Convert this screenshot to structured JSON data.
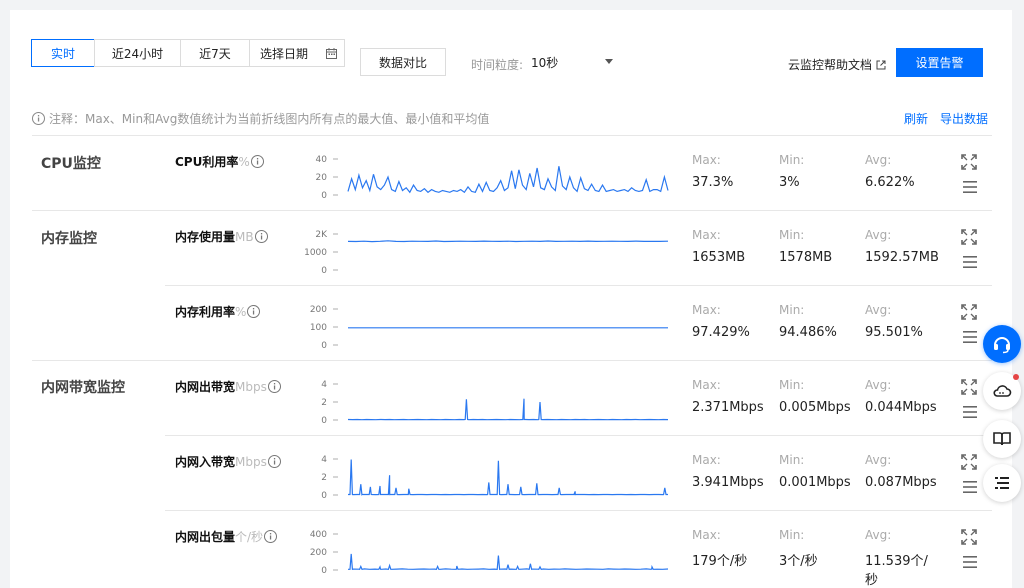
{
  "toolbar": {
    "tabs": [
      {
        "label": "实时",
        "active": true
      },
      {
        "label": "近24小时",
        "active": false
      },
      {
        "label": "近7天",
        "active": false
      }
    ],
    "date_picker_label": "选择日期",
    "compare_label": "数据对比",
    "granularity_label": "时间粒度:",
    "granularity_value": "10秒",
    "doc_link": "云监控帮助文档",
    "alarm_button": "设置告警"
  },
  "note": "注释：Max、Min和Avg数值统计为当前折线图内所有点的最大值、最小值和平均值",
  "actions": {
    "refresh": "刷新",
    "export": "导出数据"
  },
  "stat_labels": {
    "max": "Max:",
    "min": "Min:",
    "avg": "Avg:"
  },
  "groups": [
    {
      "label": "CPU监控"
    },
    {
      "label": "内存监控"
    },
    {
      "label": "内网带宽监控"
    }
  ],
  "metrics": [
    {
      "name": "CPU利用率",
      "unit": "%",
      "y_ticks": [
        "40",
        "20",
        "0"
      ],
      "ylim": [
        0,
        40
      ],
      "series": [
        4,
        18,
        6,
        22,
        8,
        16,
        5,
        23,
        9,
        6,
        11,
        20,
        6,
        4,
        15,
        5,
        8,
        3,
        11,
        5,
        4,
        7,
        3,
        6,
        4,
        3,
        5,
        4,
        3,
        5,
        4,
        6,
        3,
        9,
        4,
        3,
        12,
        4,
        14,
        5,
        4,
        8,
        16,
        5,
        8,
        27,
        7,
        28,
        11,
        6,
        24,
        9,
        30,
        8,
        6,
        18,
        9,
        5,
        32,
        10,
        6,
        20,
        8,
        4,
        19,
        7,
        5,
        12,
        5,
        4,
        11,
        4,
        5,
        6,
        4,
        5,
        6,
        4,
        8,
        5,
        4,
        5,
        17,
        4,
        6,
        6,
        4,
        20,
        5
      ],
      "stats": {
        "max": "37.3%",
        "min": "3%",
        "avg": "6.622%"
      }
    },
    {
      "name": "内存使用量",
      "unit": "MB",
      "y_ticks": [
        "2K",
        "1000",
        "0"
      ],
      "ylim": [
        0,
        2000
      ],
      "series": [
        1590,
        1585,
        1600,
        1580,
        1595,
        1620,
        1590,
        1585,
        1600,
        1595,
        1590,
        1610,
        1585,
        1590,
        1600,
        1595,
        1588,
        1605,
        1592,
        1590,
        1600,
        1585,
        1595,
        1600,
        1590,
        1610,
        1588,
        1592,
        1598,
        1590,
        1603,
        1587,
        1595,
        1600,
        1592,
        1590,
        1605,
        1588,
        1596,
        1590,
        1600
      ],
      "stats": {
        "max": "1653MB",
        "min": "1578MB",
        "avg": "1592.57MB"
      }
    },
    {
      "name": "内存利用率",
      "unit": "%",
      "y_ticks": [
        "200",
        "100",
        "0"
      ],
      "ylim": [
        0,
        200
      ],
      "series": [
        95.5,
        95.4,
        95.6,
        95.5,
        95.3,
        95.5,
        95.6,
        95.4,
        95.5,
        95.5,
        95.6,
        95.4,
        95.5,
        95.5,
        95.6,
        95.5,
        95.4,
        95.5,
        95.6,
        95.5,
        95.5
      ],
      "stats": {
        "max": "97.429%",
        "min": "94.486%",
        "avg": "95.501%"
      }
    },
    {
      "name": "内网出带宽",
      "unit": "Mbps",
      "y_ticks": [
        "4",
        "2",
        "0"
      ],
      "ylim": [
        0,
        4
      ],
      "series": [
        0.05,
        0.04,
        0.05,
        0.03,
        0.05,
        0.04,
        0.03,
        0.05,
        0.04,
        0.05,
        0.03,
        0.04,
        0.05,
        0.03,
        0.04,
        0.05,
        0.04,
        0.03,
        0.05,
        0.04,
        0.03,
        0.05,
        0.04,
        0.03,
        0.05,
        0.04,
        0.03,
        0.05,
        0.04,
        0.05,
        0.03,
        0.04,
        0.05,
        0.04,
        0.03,
        0.05,
        0.04,
        0.03,
        0.05,
        0.04,
        0.05,
        0.03,
        0.04,
        0.05,
        0.04,
        0.03,
        0.05,
        0.04,
        0.03,
        0.05,
        0.04,
        0.05,
        0.03,
        0.04,
        0.05,
        0.04,
        0.03,
        0.05,
        0.04,
        0.03,
        0.05,
        0.04,
        0.05,
        0.03,
        0.04,
        0.05,
        0.04,
        0.03,
        0.05,
        0.04
      ],
      "spikes": [
        [
          0.37,
          2.3
        ],
        [
          0.55,
          2.37
        ],
        [
          0.6,
          2.0
        ]
      ],
      "stats": {
        "max": "2.371Mbps",
        "min": "0.005Mbps",
        "avg": "0.044Mbps"
      }
    },
    {
      "name": "内网入带宽",
      "unit": "Mbps",
      "y_ticks": [
        "4",
        "2",
        "0"
      ],
      "ylim": [
        0,
        4
      ],
      "series": [
        0.05,
        0.04,
        0.06,
        0.04,
        0.05,
        0.07,
        0.04,
        0.05,
        0.06,
        0.04,
        0.05,
        0.04,
        0.06,
        0.05,
        0.04,
        0.06,
        0.05,
        0.04,
        0.05,
        0.06,
        0.04,
        0.05,
        0.04,
        0.06,
        0.05,
        0.04,
        0.05,
        0.06,
        0.04,
        0.05,
        0.04,
        0.06,
        0.05,
        0.04,
        0.05,
        0.06,
        0.04,
        0.05,
        0.04,
        0.06,
        0.05,
        0.04,
        0.05,
        0.06,
        0.04,
        0.05,
        0.04,
        0.06,
        0.05,
        0.04,
        0.05,
        0.06,
        0.04,
        0.05,
        0.04,
        0.06,
        0.05,
        0.04,
        0.05,
        0.06,
        0.04,
        0.05,
        0.04,
        0.06,
        0.05,
        0.04,
        0.05,
        0.06,
        0.04,
        0.05
      ],
      "spikes": [
        [
          0.01,
          3.94
        ],
        [
          0.04,
          1.2
        ],
        [
          0.07,
          0.9
        ],
        [
          0.1,
          1.0
        ],
        [
          0.13,
          2.2
        ],
        [
          0.15,
          0.8
        ],
        [
          0.19,
          0.7
        ],
        [
          0.44,
          1.4
        ],
        [
          0.47,
          3.8
        ],
        [
          0.5,
          1.2
        ],
        [
          0.54,
          0.9
        ],
        [
          0.59,
          1.3
        ],
        [
          0.66,
          0.8
        ],
        [
          0.71,
          0.4
        ],
        [
          0.99,
          0.8
        ]
      ],
      "stats": {
        "max": "3.941Mbps",
        "min": "0.001Mbps",
        "avg": "0.087Mbps"
      }
    },
    {
      "name": "内网出包量",
      "unit": "个/秒",
      "y_ticks": [
        "400",
        "200",
        "0"
      ],
      "ylim": [
        0,
        400
      ],
      "series": [
        8,
        10,
        9,
        12,
        8,
        10,
        9,
        11,
        8,
        10,
        12,
        9,
        8,
        10,
        11,
        9,
        10,
        8,
        12,
        9,
        10,
        11,
        8,
        9,
        10,
        12,
        8,
        10,
        9,
        11,
        10,
        8,
        9,
        12,
        10,
        9,
        11,
        8,
        10,
        9,
        12,
        10,
        8,
        9,
        11,
        10,
        9,
        8,
        12,
        10,
        9,
        11,
        10,
        8,
        9,
        12,
        10,
        9,
        8,
        11
      ],
      "spikes": [
        [
          0.01,
          179
        ],
        [
          0.04,
          40
        ],
        [
          0.1,
          35
        ],
        [
          0.13,
          50
        ],
        [
          0.28,
          40
        ],
        [
          0.34,
          45
        ],
        [
          0.47,
          160
        ],
        [
          0.5,
          60
        ],
        [
          0.53,
          40
        ],
        [
          0.57,
          70
        ],
        [
          0.6,
          35
        ],
        [
          0.95,
          35
        ]
      ],
      "stats": {
        "max": "179个/秒",
        "min": "3个/秒",
        "avg": "11.539个/秒"
      }
    }
  ],
  "colors": {
    "accent": "#006eff",
    "line": "#2a78f0",
    "alert_dot": "#e54545"
  }
}
